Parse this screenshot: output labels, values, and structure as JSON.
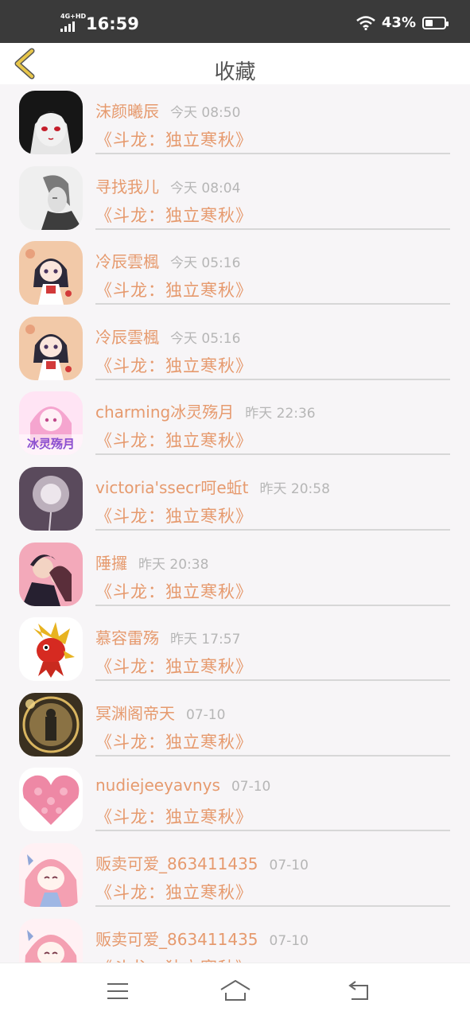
{
  "status_bar": {
    "network": "4G+HD",
    "time": "16:59",
    "battery": "43%",
    "battery_level": 0.43
  },
  "header": {
    "title": "收藏",
    "back_icon": "chevron-left-icon",
    "accent_color": "#e8c64a"
  },
  "favorites": [
    {
      "name": "沫颜曦辰",
      "time": "今天 08:50",
      "book": "《斗龙：独立寒秋》",
      "avatar": "avatar-dark-anime-girl"
    },
    {
      "name": "寻找我儿",
      "time": "今天 08:04",
      "book": "《斗龙：独立寒秋》",
      "avatar": "avatar-grey-anime-boy"
    },
    {
      "name": "冷辰雲楓",
      "time": "今天 05:16",
      "book": "《斗龙：独立寒秋》",
      "avatar": "avatar-chibi-girl"
    },
    {
      "name": "冷辰雲楓",
      "time": "今天 05:16",
      "book": "《斗龙：独立寒秋》",
      "avatar": "avatar-chibi-girl"
    },
    {
      "name": "charming冰灵殇月",
      "time": "昨天 22:36",
      "book": "《斗龙：独立寒秋》",
      "avatar": "avatar-pink-girl-text",
      "avatar_text": "冰灵殇月"
    },
    {
      "name": "victoria'ssecr呵e蚯t",
      "time": "昨天 20:58",
      "book": "《斗龙：独立寒秋》",
      "avatar": "avatar-dandelion"
    },
    {
      "name": "陲攞",
      "time": "昨天 20:38",
      "book": "《斗龙：独立寒秋》",
      "avatar": "avatar-couple"
    },
    {
      "name": "慕容雷殇",
      "time": "昨天 17:57",
      "book": "《斗龙：独立寒秋》",
      "avatar": "avatar-red-dragon"
    },
    {
      "name": "冥渊阁帝天",
      "time": "07-10",
      "book": "《斗龙：独立寒秋》",
      "avatar": "avatar-golden-frame"
    },
    {
      "name": "nudiejeeyavnys",
      "time": "07-10",
      "book": "《斗龙：独立寒秋》",
      "avatar": "avatar-pink-heart"
    },
    {
      "name": "贩卖可爱_863411435",
      "time": "07-10",
      "book": "《斗龙：独立寒秋》",
      "avatar": "avatar-pink-hair-girl"
    },
    {
      "name": "贩卖可爱_863411435",
      "time": "07-10",
      "book": "《斗龙：独立寒秋》",
      "avatar": "avatar-pink-hair-girl"
    }
  ],
  "bottom_nav": {
    "menu_icon": "menu-icon",
    "home_icon": "home-icon",
    "back_icon": "back-icon"
  }
}
